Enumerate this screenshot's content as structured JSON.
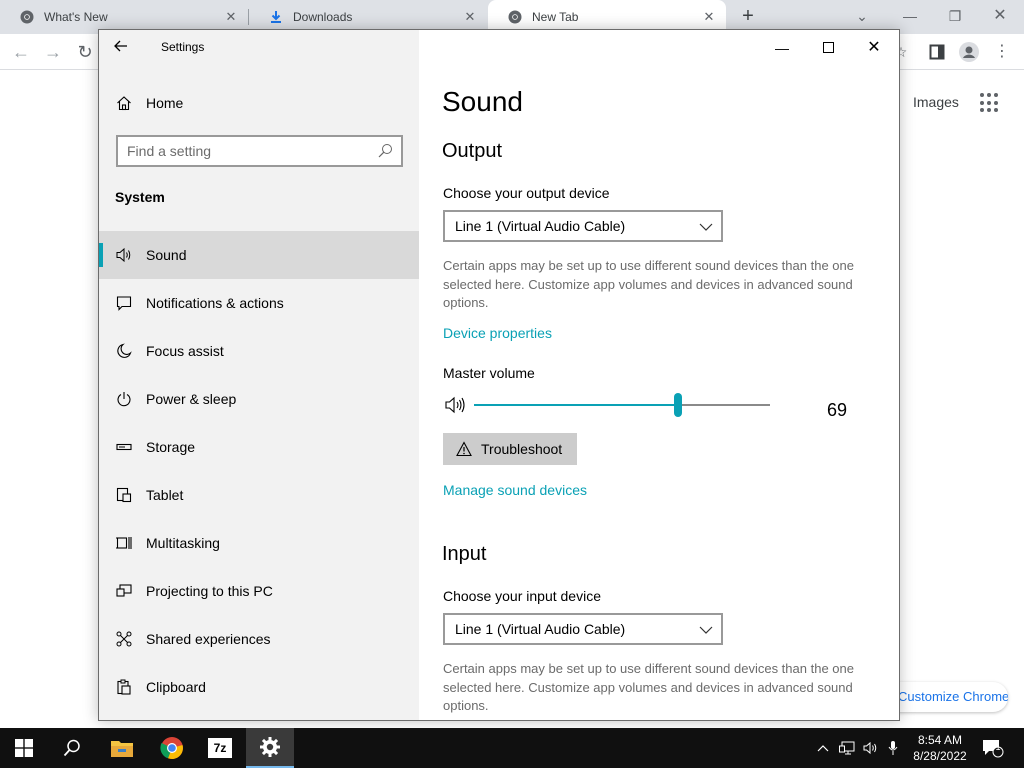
{
  "browser": {
    "tabs": [
      {
        "title": "What's New",
        "icon": "chrome-icon",
        "active": false
      },
      {
        "title": "Downloads",
        "icon": "download-icon",
        "active": false
      },
      {
        "title": "New Tab",
        "icon": "chrome-icon",
        "active": true
      }
    ],
    "new_tab_symbol": "+",
    "images_link": "Images",
    "customize_button": "Customize Chrome"
  },
  "settings": {
    "window_title": "Settings",
    "home_label": "Home",
    "search_placeholder": "Find a setting",
    "section_label": "System",
    "nav_items": [
      {
        "label": "Sound",
        "icon": "speaker-icon",
        "selected": true
      },
      {
        "label": "Notifications & actions",
        "icon": "notification-icon",
        "selected": false
      },
      {
        "label": "Focus assist",
        "icon": "moon-icon",
        "selected": false
      },
      {
        "label": "Power & sleep",
        "icon": "power-icon",
        "selected": false
      },
      {
        "label": "Storage",
        "icon": "storage-icon",
        "selected": false
      },
      {
        "label": "Tablet",
        "icon": "tablet-icon",
        "selected": false
      },
      {
        "label": "Multitasking",
        "icon": "multitasking-icon",
        "selected": false
      },
      {
        "label": "Projecting to this PC",
        "icon": "projecting-icon",
        "selected": false
      },
      {
        "label": "Shared experiences",
        "icon": "shared-icon",
        "selected": false
      },
      {
        "label": "Clipboard",
        "icon": "clipboard-icon",
        "selected": false
      }
    ],
    "page_title": "Sound",
    "output": {
      "heading": "Output",
      "device_label": "Choose your output device",
      "device_value": "Line 1 (Virtual Audio Cable)",
      "description": "Certain apps may be set up to use different sound devices than the one selected here. Customize app volumes and devices in advanced sound options.",
      "device_properties_link": "Device properties",
      "master_volume_label": "Master volume",
      "master_volume_value": "69",
      "master_volume_level": 0.69,
      "troubleshoot_label": "Troubleshoot",
      "manage_link": "Manage sound devices"
    },
    "input": {
      "heading": "Input",
      "device_label": "Choose your input device",
      "device_value": "Line 1 (Virtual Audio Cable)",
      "description": "Certain apps may be set up to use different sound devices than the one selected here. Customize app volumes and devices in advanced sound options."
    },
    "accent_color": "#0aa1b5"
  },
  "taskbar": {
    "apps": [
      "start-icon",
      "search-icon",
      "file-explorer-icon",
      "chrome-icon",
      "7zip-icon",
      "settings-icon"
    ],
    "sevenzip_label": "7z",
    "time": "8:54 AM",
    "date": "8/28/2022",
    "notification_count": "1"
  }
}
